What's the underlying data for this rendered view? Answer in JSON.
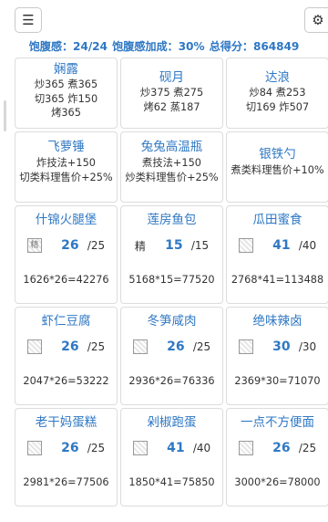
{
  "toolbar": {
    "menu_icon": "menu-icon",
    "menu_glyph": "☰",
    "settings_icon": "gear-icon",
    "settings_glyph": "⚙"
  },
  "summary": {
    "satiety": "饱腹感：24/24",
    "bonus": "饱腹感加成：30%",
    "total": "总得分：864849"
  },
  "chefs": [
    {
      "name": "娴露",
      "lines": [
        "炒365 煮365",
        "切365 炸150",
        "烤365"
      ]
    },
    {
      "name": "砚月",
      "lines": [
        "炒375 煮275",
        "烤62 蒸187"
      ]
    },
    {
      "name": "达浪",
      "lines": [
        "炒84 煮253",
        "切169 炸507"
      ]
    }
  ],
  "tools": [
    {
      "name": "飞萝锤",
      "lines": [
        "炸技法+150",
        "切类料理售价+25%"
      ]
    },
    {
      "name": "兔兔高温瓶",
      "lines": [
        "煮技法+150",
        "炒类料理售价+25%"
      ]
    },
    {
      "name": "银铁勺",
      "lines": [
        "煮类料理售价+10%"
      ]
    }
  ],
  "dishes": [
    {
      "name": "什锦火腿堡",
      "thumb": "精",
      "qty": "26",
      "max": "/25",
      "formula": "1626*26=42276",
      "thumb_style": "image"
    },
    {
      "name": "莲房鱼包",
      "thumb": "精",
      "qty": "15",
      "max": "/15",
      "formula": "5168*15=77520",
      "thumb_style": "text"
    },
    {
      "name": "瓜田蜜食",
      "thumb": "",
      "qty": "41",
      "max": "/40",
      "formula": "2768*41=113488",
      "thumb_style": "image"
    },
    {
      "name": "虾仁豆腐",
      "thumb": "",
      "qty": "26",
      "max": "/25",
      "formula": "2047*26=53222",
      "thumb_style": "image"
    },
    {
      "name": "冬笋咸肉",
      "thumb": "",
      "qty": "26",
      "max": "/25",
      "formula": "2936*26=76336",
      "thumb_style": "image"
    },
    {
      "name": "绝味辣卤",
      "thumb": "",
      "qty": "30",
      "max": "/30",
      "formula": "2369*30=71070",
      "thumb_style": "image"
    },
    {
      "name": "老干妈蛋糕",
      "thumb": "",
      "qty": "26",
      "max": "/25",
      "formula": "2981*26=77506",
      "thumb_style": "image"
    },
    {
      "name": "剁椒跑蛋",
      "thumb": "",
      "qty": "41",
      "max": "/40",
      "formula": "1850*41=75850",
      "thumb_style": "image"
    },
    {
      "name": "一点不方便面",
      "thumb": "",
      "qty": "26",
      "max": "/25",
      "formula": "3000*26=78000",
      "thumb_style": "image"
    }
  ]
}
